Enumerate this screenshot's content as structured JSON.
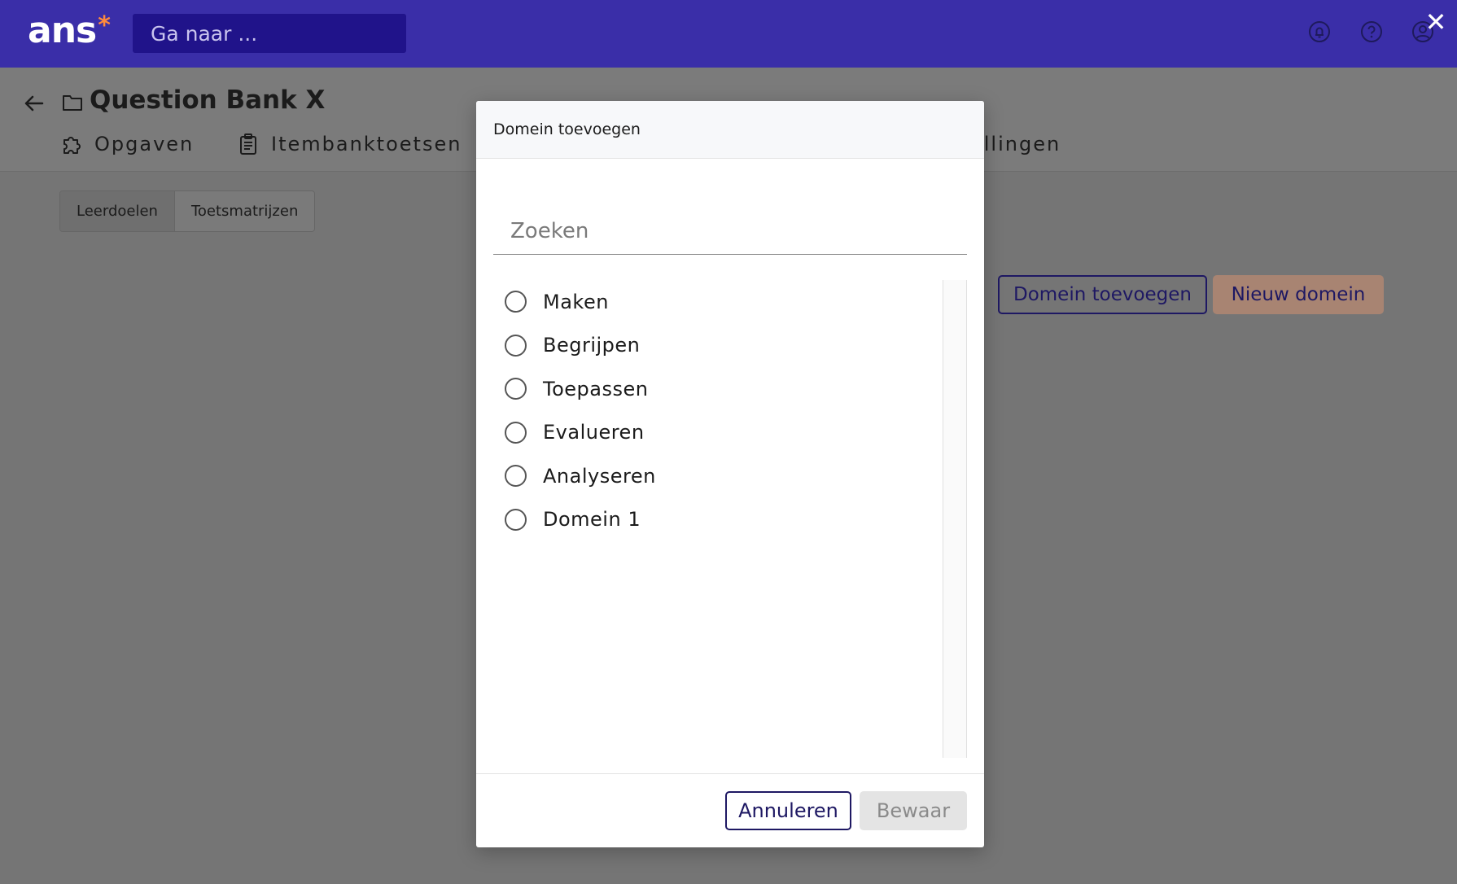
{
  "app": {
    "logo_text": "ans",
    "logo_mark": "*",
    "search_placeholder": "Ga naar ...",
    "icons": [
      "bell-icon",
      "help-icon",
      "account-icon",
      "close-icon"
    ]
  },
  "page": {
    "title": "Question Bank X",
    "tabs": [
      {
        "label": "Opgaven",
        "icon": "puzzle-icon"
      },
      {
        "label": "Itembanktoetsen",
        "icon": "clipboard-icon"
      },
      {
        "label": "ellingen",
        "icon": ""
      }
    ],
    "subtabs": [
      {
        "label": "Leerdoelen",
        "active": true
      },
      {
        "label": "Toetsmatrijzen",
        "active": false
      }
    ],
    "add_domain_label": "Domein toevoegen",
    "new_domain_label": "Nieuw domein"
  },
  "modal": {
    "title": "Domein toevoegen",
    "search_placeholder": "Zoeken",
    "options": [
      "Maken",
      "Begrijpen",
      "Toepassen",
      "Evalueren",
      "Analyseren",
      "Domein 1"
    ],
    "cancel_label": "Annuleren",
    "save_label": "Bewaar"
  },
  "colors": {
    "topbar": "#3a2ea8",
    "primary": "#1e1863",
    "accent": "#ff8a3d"
  }
}
